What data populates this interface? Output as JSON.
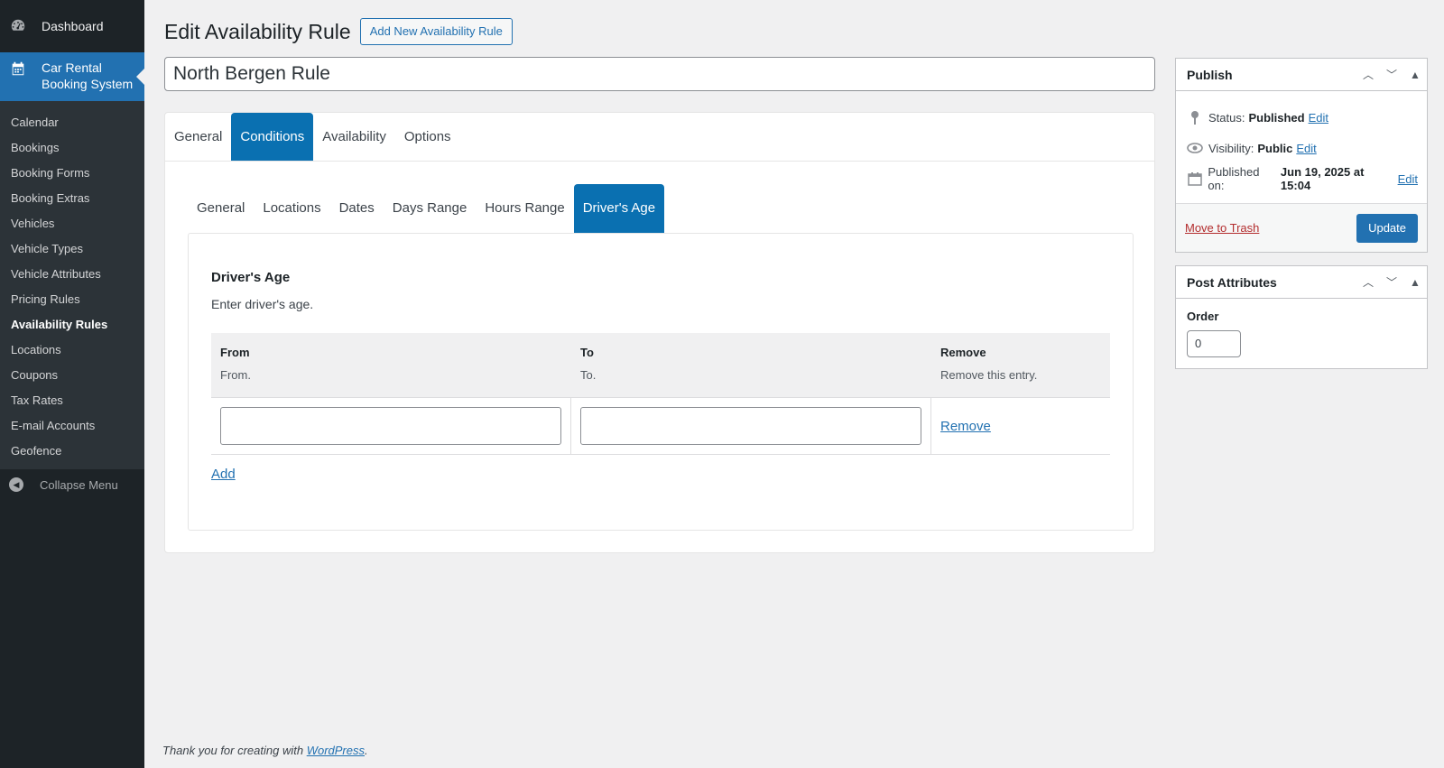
{
  "sidebar": {
    "dashboard": "Dashboard",
    "current": {
      "line1": "Car Rental",
      "line2": "Booking System"
    },
    "items": [
      {
        "label": "Calendar"
      },
      {
        "label": "Bookings"
      },
      {
        "label": "Booking Forms"
      },
      {
        "label": "Booking Extras"
      },
      {
        "label": "Vehicles"
      },
      {
        "label": "Vehicle Types"
      },
      {
        "label": "Vehicle Attributes"
      },
      {
        "label": "Pricing Rules"
      },
      {
        "label": "Availability Rules"
      },
      {
        "label": "Locations"
      },
      {
        "label": "Coupons"
      },
      {
        "label": "Tax Rates"
      },
      {
        "label": "E-mail Accounts"
      },
      {
        "label": "Geofence"
      }
    ],
    "collapse": "Collapse Menu"
  },
  "page": {
    "title": "Edit Availability Rule",
    "add_new": "Add New Availability Rule",
    "post_title": "North Bergen Rule"
  },
  "tabs1": [
    {
      "label": "General"
    },
    {
      "label": "Conditions"
    },
    {
      "label": "Availability"
    },
    {
      "label": "Options"
    }
  ],
  "tabs2": [
    {
      "label": "General"
    },
    {
      "label": "Locations"
    },
    {
      "label": "Dates"
    },
    {
      "label": "Days Range"
    },
    {
      "label": "Hours Range"
    },
    {
      "label": "Driver's Age"
    }
  ],
  "section": {
    "title": "Driver's Age",
    "desc": "Enter driver's age.",
    "columns": [
      {
        "title": "From",
        "desc": "From."
      },
      {
        "title": "To",
        "desc": "To."
      },
      {
        "title": "Remove",
        "desc": "Remove this entry."
      }
    ],
    "row": {
      "from": "",
      "to": "",
      "remove": "Remove"
    },
    "add": "Add"
  },
  "footer": {
    "text": "Thank you for creating with ",
    "link": "WordPress",
    "end": "."
  },
  "publish": {
    "title": "Publish",
    "status_label": "Status:",
    "status_value": "Published",
    "visibility_label": "Visibility:",
    "visibility_value": "Public",
    "published_label": "Published on:",
    "published_value": "Jun 19, 2025 at 15:04",
    "edit": "Edit",
    "trash": "Move to Trash",
    "update": "Update"
  },
  "attributes": {
    "title": "Post Attributes",
    "order_label": "Order",
    "order_value": "0"
  },
  "colors": {
    "accent": "#2271b1",
    "tab_active": "#0a70b1",
    "sidebar": "#1d2327"
  }
}
